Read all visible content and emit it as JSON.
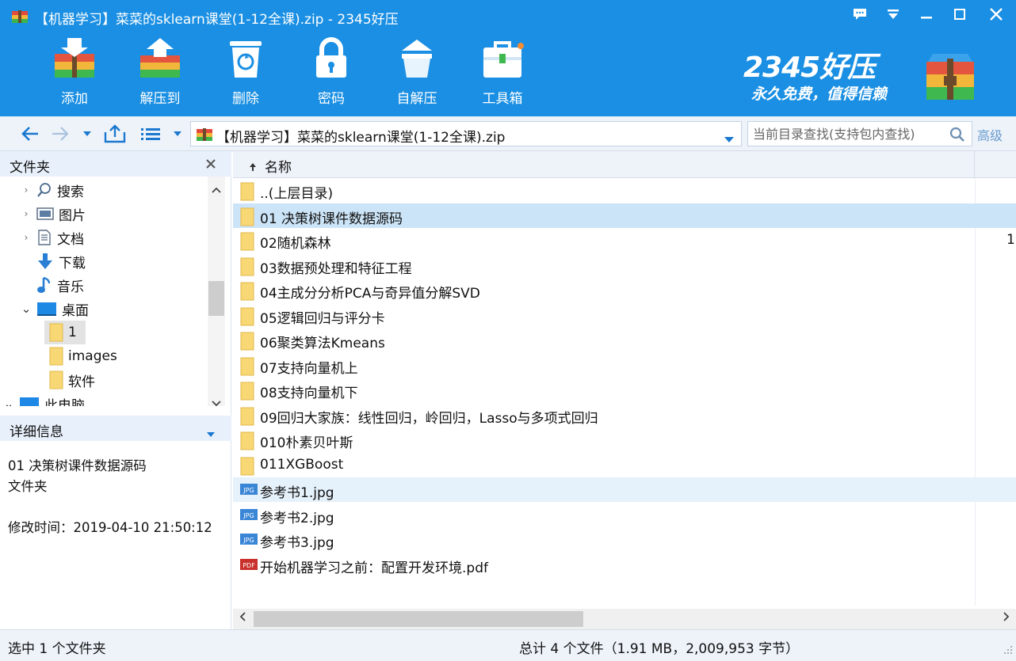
{
  "window": {
    "title": "【机器学习】菜菜的sklearn课堂(1-12全课).zip - 2345好压"
  },
  "toolbar": {
    "items": [
      {
        "label": "添加",
        "icon": "add-archive-icon"
      },
      {
        "label": "解压到",
        "icon": "extract-to-icon"
      },
      {
        "label": "删除",
        "icon": "delete-icon"
      },
      {
        "label": "密码",
        "icon": "password-lock-icon"
      },
      {
        "label": "自解压",
        "icon": "self-extract-icon"
      },
      {
        "label": "工具箱",
        "icon": "toolbox-icon"
      }
    ]
  },
  "brand": {
    "name": "2345好压",
    "slogan": "永久免费，值得信赖"
  },
  "address": {
    "path": "【机器学习】菜菜的sklearn课堂(1-12全课).zip",
    "search_placeholder": "当前目录查找(支持包内查找)",
    "advanced_label": "高级"
  },
  "left_panel": {
    "folders_title": "文件夹",
    "tree": [
      {
        "label": "搜索",
        "icon": "search-icon",
        "chevron": "›"
      },
      {
        "label": "图片",
        "icon": "pictures-icon",
        "chevron": "›"
      },
      {
        "label": "文档",
        "icon": "documents-icon",
        "chevron": "›"
      },
      {
        "label": "下载",
        "icon": "download-icon",
        "chevron": ""
      },
      {
        "label": "音乐",
        "icon": "music-icon",
        "chevron": ""
      },
      {
        "label": "桌面",
        "icon": "desktop-icon",
        "chevron": "⌄"
      },
      {
        "label": "1",
        "icon": "folder-icon",
        "chevron": ""
      },
      {
        "label": "images",
        "icon": "folder-icon",
        "chevron": ""
      },
      {
        "label": "软件",
        "icon": "folder-icon",
        "chevron": ""
      },
      {
        "label": "此电脑",
        "icon": "computer-icon",
        "chevron": "⌄"
      }
    ],
    "details_title": "详细信息",
    "details": {
      "name": "01 决策树课件数据源码",
      "type": "文件夹",
      "modified": "修改时间：2019-04-10 21:50:12"
    }
  },
  "filelist": {
    "column_name": "名称",
    "rows": [
      {
        "name": "..(上层目录)",
        "type": "folder"
      },
      {
        "name": "01 决策树课件数据源码",
        "type": "folder"
      },
      {
        "name": "02随机森林",
        "type": "folder",
        "extra": "1"
      },
      {
        "name": "03数据预处理和特征工程",
        "type": "folder"
      },
      {
        "name": "04主成分分析PCA与奇异值分解SVD",
        "type": "folder"
      },
      {
        "name": "05逻辑回归与评分卡",
        "type": "folder"
      },
      {
        "name": "06聚类算法Kmeans",
        "type": "folder"
      },
      {
        "name": "07支持向量机上",
        "type": "folder"
      },
      {
        "name": "08支持向量机下",
        "type": "folder"
      },
      {
        "name": "09回归大家族：线性回归，岭回归，Lasso与多项式回归",
        "type": "folder"
      },
      {
        "name": "010朴素贝叶斯",
        "type": "folder"
      },
      {
        "name": "011XGBoost",
        "type": "folder"
      },
      {
        "name": "参考书1.jpg",
        "type": "jpg"
      },
      {
        "name": "参考书2.jpg",
        "type": "jpg"
      },
      {
        "name": "参考书3.jpg",
        "type": "jpg"
      },
      {
        "name": "开始机器学习之前：配置开发环境.pdf",
        "type": "pdf"
      }
    ]
  },
  "status": {
    "selection": "选中 1 个文件夹",
    "total": "总计 4 个文件（1.91 MB，2,009,953 字节）"
  },
  "colors": {
    "header_blue": "#1a8fe3",
    "selected_row": "#cce4f7",
    "folder_yellow": "#f8d775"
  }
}
